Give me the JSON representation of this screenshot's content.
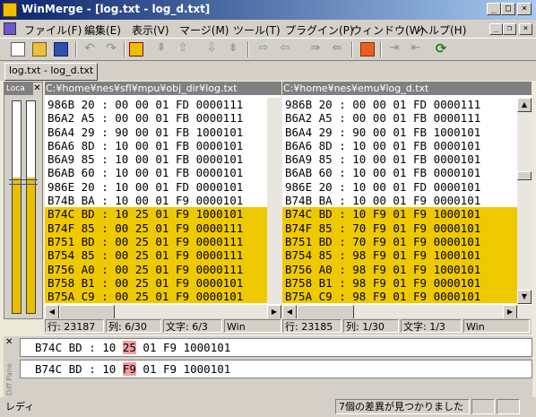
{
  "window": {
    "title": "WinMerge - [log.txt - log_d.txt]"
  },
  "menu": [
    "ファイル(F)",
    "編集(E)",
    "表示(V)",
    "マージ(M)",
    "ツール(T)",
    "プラグイン(P)",
    "ウィンドウ(W)",
    "ヘルプ(H)"
  ],
  "toolbar_icons": [
    "new-icon",
    "open-icon",
    "save-icon",
    "undo-icon",
    "redo-icon",
    "next-diff-icon",
    "first-diff-icon",
    "prev-diff-icon",
    "down-diff-icon",
    "last-diff-icon",
    "copy-right-icon",
    "copy-left-icon",
    "options-icon",
    "copy-all-right-icon",
    "copy-all-left-icon",
    "refresh-icon"
  ],
  "tab": {
    "label": "log.txt - log_d.txt"
  },
  "location_pane": {
    "title": "Loca",
    "left_fill": 0.64,
    "right_fill": 0.64
  },
  "left_pane": {
    "path": "C:¥home¥nes¥sfl¥mpu¥obj_dir¥log.txt",
    "lines": [
      {
        "text": "986B 20 : 00 00 01 FD 0000111",
        "diff": false
      },
      {
        "text": "B6A2 A5 : 00 00 01 FB 0000111",
        "diff": false
      },
      {
        "text": "B6A4 29 : 90 00 01 FB 1000101",
        "diff": false
      },
      {
        "text": "B6A6 8D : 10 00 01 FB 0000101",
        "diff": false
      },
      {
        "text": "B6A9 85 : 10 00 01 FB 0000101",
        "diff": false
      },
      {
        "text": "B6AB 60 : 10 00 01 FB 0000101",
        "diff": false
      },
      {
        "text": "986E 20 : 10 00 01 FD 0000101",
        "diff": false
      },
      {
        "text": "B74B BA : 10 00 01 F9 0000101",
        "diff": false
      },
      {
        "text": "B74C BD : 10 25 01 F9 1000101",
        "diff": true
      },
      {
        "text": "B74F 85 : 00 25 01 F9 0000111",
        "diff": true
      },
      {
        "text": "B751 BD : 00 25 01 F9 0000111",
        "diff": true
      },
      {
        "text": "B754 85 : 00 25 01 F9 0000111",
        "diff": true
      },
      {
        "text": "B756 A0 : 00 25 01 F9 0000111",
        "diff": true
      },
      {
        "text": "B758 B1 : 00 25 01 F9 0000101",
        "diff": true
      },
      {
        "text": "B75A C9 : 00 25 01 F9 0000101",
        "diff": true
      }
    ],
    "status": {
      "line": "行: 23187",
      "col": "列: 6/30",
      "chars": "文字: 6/3",
      "eol": "Win"
    }
  },
  "right_pane": {
    "path": "C:¥home¥nes¥emu¥log_d.txt",
    "lines": [
      {
        "text": "986B 20 : 00 00 01 FD 0000111",
        "diff": false
      },
      {
        "text": "B6A2 A5 : 00 00 01 FB 0000111",
        "diff": false
      },
      {
        "text": "B6A4 29 : 90 00 01 FB 1000101",
        "diff": false
      },
      {
        "text": "B6A6 8D : 10 00 01 FB 0000101",
        "diff": false
      },
      {
        "text": "B6A9 85 : 10 00 01 FB 0000101",
        "diff": false
      },
      {
        "text": "B6AB 60 : 10 00 01 FB 0000101",
        "diff": false
      },
      {
        "text": "986E 20 : 10 00 01 FD 0000101",
        "diff": false
      },
      {
        "text": "B74B BA : 10 00 01 F9 0000101",
        "diff": false
      },
      {
        "text": "B74C BD : 10 F9 01 F9 1000101",
        "diff": true
      },
      {
        "text": "B74F 85 : 70 F9 01 F9 0000101",
        "diff": true
      },
      {
        "text": "B751 BD : 70 F9 01 F9 0000101",
        "diff": true
      },
      {
        "text": "B754 85 : 98 F9 01 F9 1000101",
        "diff": true
      },
      {
        "text": "B756 A0 : 98 F9 01 F9 1000101",
        "diff": true
      },
      {
        "text": "B758 B1 : 98 F9 01 F9 0000101",
        "diff": true
      },
      {
        "text": "B75A C9 : 98 F9 01 F9 0000101",
        "diff": true
      }
    ],
    "status": {
      "line": "行: 23185",
      "col": "列: 1/30",
      "chars": "文字: 1/3",
      "eol": "Win"
    }
  },
  "diff_detail": {
    "label": "Diff Pane",
    "top": {
      "before": "B74C BD : 10 ",
      "highlight": "25",
      "after": " 01 F9 1000101"
    },
    "bottom": {
      "before": "B74C BD : 10 ",
      "highlight": "F9",
      "after": " 01 F9 1000101"
    }
  },
  "statusbar": {
    "ready": "レディ",
    "diff_count": "7個の差異が見つかりました"
  }
}
